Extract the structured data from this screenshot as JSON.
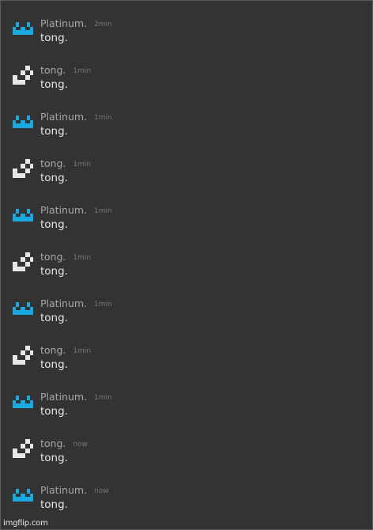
{
  "messages": [
    {
      "user": "Platinum.",
      "time": "2min",
      "text": "tong.",
      "avatar": "blue-castle-icon"
    },
    {
      "user": "tong.",
      "time": "1min",
      "text": "tong.",
      "avatar": "white-check-icon"
    },
    {
      "user": "Platinum.",
      "time": "1min",
      "text": "tong.",
      "avatar": "blue-castle-icon"
    },
    {
      "user": "tong.",
      "time": "1min",
      "text": "tong.",
      "avatar": "white-check-icon"
    },
    {
      "user": "Platinum.",
      "time": "1min",
      "text": "tong.",
      "avatar": "blue-castle-icon"
    },
    {
      "user": "tong.",
      "time": "1min",
      "text": "tong.",
      "avatar": "white-check-icon"
    },
    {
      "user": "Platinum.",
      "time": "1min",
      "text": "tong.",
      "avatar": "blue-castle-icon"
    },
    {
      "user": "tong.",
      "time": "1min",
      "text": "tong.",
      "avatar": "white-check-icon"
    },
    {
      "user": "Platinum.",
      "time": "1min",
      "text": "tong.",
      "avatar": "blue-castle-icon"
    },
    {
      "user": "tong.",
      "time": "now",
      "text": "tong.",
      "avatar": "white-check-icon"
    },
    {
      "user": "Platinum.",
      "time": "now",
      "text": "tong.",
      "avatar": "blue-castle-icon"
    }
  ],
  "watermark": "imgflip.com",
  "colors": {
    "background": "#333333",
    "platinum_avatar": "#1aa8e0",
    "tong_avatar": "#e6e6e6",
    "username": "#a8a8a8",
    "timestamp": "#777777",
    "message_text": "#e4e4e4"
  }
}
